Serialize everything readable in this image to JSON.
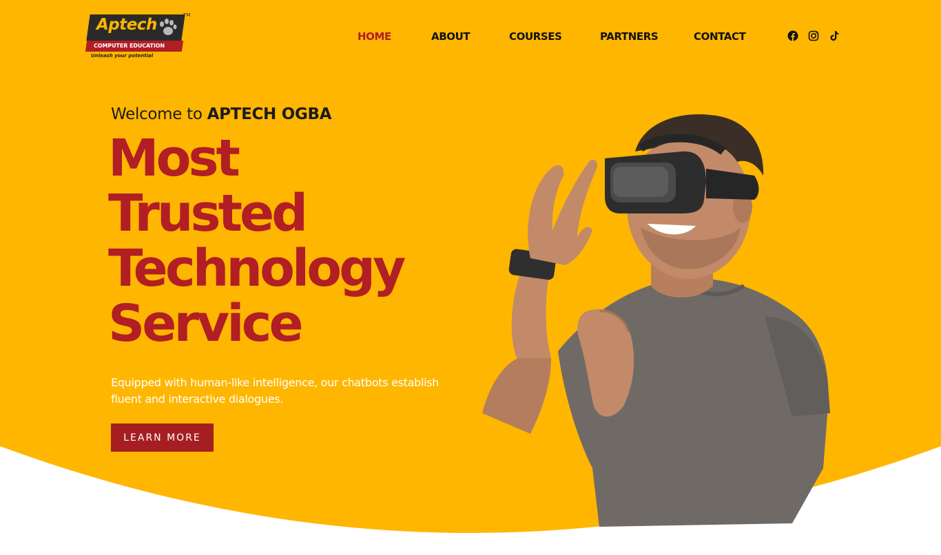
{
  "brand": {
    "name": "Aptech",
    "band_text": "COMPUTER EDUCATION",
    "tagline": "Unleash your potential",
    "trademark": "TM",
    "colors": {
      "primary_yellow": "#FFB600",
      "brand_red": "#B11E24",
      "dark": "#2a2a2a"
    }
  },
  "nav": {
    "items": [
      {
        "label": "HOME",
        "active": true
      },
      {
        "label": "ABOUT",
        "active": false
      },
      {
        "label": "COURSES",
        "active": false
      },
      {
        "label": "PARTNERS",
        "active": false
      },
      {
        "label": "CONTACT",
        "active": false
      }
    ],
    "social": [
      "facebook-icon",
      "instagram-icon",
      "tiktok-icon"
    ]
  },
  "hero": {
    "welcome_prefix": "Welcome to ",
    "welcome_name": "APTECH OGBA",
    "headline": [
      "Most",
      "Trusted",
      "Technology",
      "Service"
    ],
    "subtext": "Equipped with human-like intelligence, our chatbots establish fluent and interactive dialogues.",
    "cta_label": "LEARN MORE",
    "image": "man-wearing-vr-headset"
  }
}
